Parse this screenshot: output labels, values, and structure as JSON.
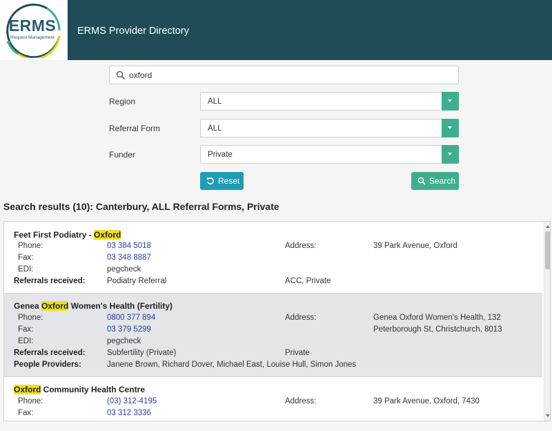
{
  "header": {
    "logo_text": "ERMS",
    "logo_subtext": "Request Management",
    "title": "ERMS Provider Directory"
  },
  "search": {
    "value": "oxford",
    "placeholder": ""
  },
  "filters": {
    "region_label": "Region",
    "region_value": "ALL",
    "referral_form_label": "Referral Form",
    "referral_form_value": "ALL",
    "funder_label": "Funder",
    "funder_value": "Private"
  },
  "buttons": {
    "reset_label": "Reset",
    "search_label": "Search"
  },
  "results_heading": "Search results (10): Canterbury, ALL Referral Forms, Private",
  "results": [
    {
      "name_before": "Feet First Podiatry - ",
      "name_highlight": "Oxford",
      "name_after": "",
      "phone_label": "Phone:",
      "phone": "03 384 5018",
      "fax_label": "Fax:",
      "fax": "03 348 8887",
      "edi_label": "EDI:",
      "edi": "pegcheck",
      "address_label": "Address:",
      "address_line1": "39 Park Avenue, Oxford",
      "address_line2": "",
      "referrals_label": "Referrals received:",
      "referrals": "Podiatry Referral",
      "funders": "ACC, Private"
    },
    {
      "name_before": "Genea ",
      "name_highlight": "Oxford",
      "name_after": " Women's Health (Fertility)",
      "phone_label": "Phone:",
      "phone": "0800 377 894",
      "fax_label": "Fax:",
      "fax": "03 379 5299",
      "edi_label": "EDI:",
      "edi": "pegcheck",
      "address_label": "Address:",
      "address_line1": "Genea Oxford Women's Health, 132",
      "address_line2": "Peterborough St, Christchurch, 8013",
      "referrals_label": "Referrals received:",
      "referrals": "Subfertility (Private)",
      "funders": "Private",
      "people_label": "People Providers:",
      "people": "Janene Brown, Richard Dover, Michael East, Louise Hull, Simon Jones"
    },
    {
      "name_before": "",
      "name_highlight": "Oxford",
      "name_after": " Community Health Centre",
      "phone_label": "Phone:",
      "phone": "(03) 312-4195",
      "fax_label": "Fax:",
      "fax": "03 312 3336",
      "address_label": "Address:",
      "address_line1": "39 Park Avenue, Oxford, 7430"
    }
  ],
  "colors": {
    "title_bar": "#1f4c57",
    "accent_green": "#3fae8e",
    "reset_blue": "#1f9cb5",
    "highlight": "#f0e020",
    "link": "#2a3fa0"
  }
}
